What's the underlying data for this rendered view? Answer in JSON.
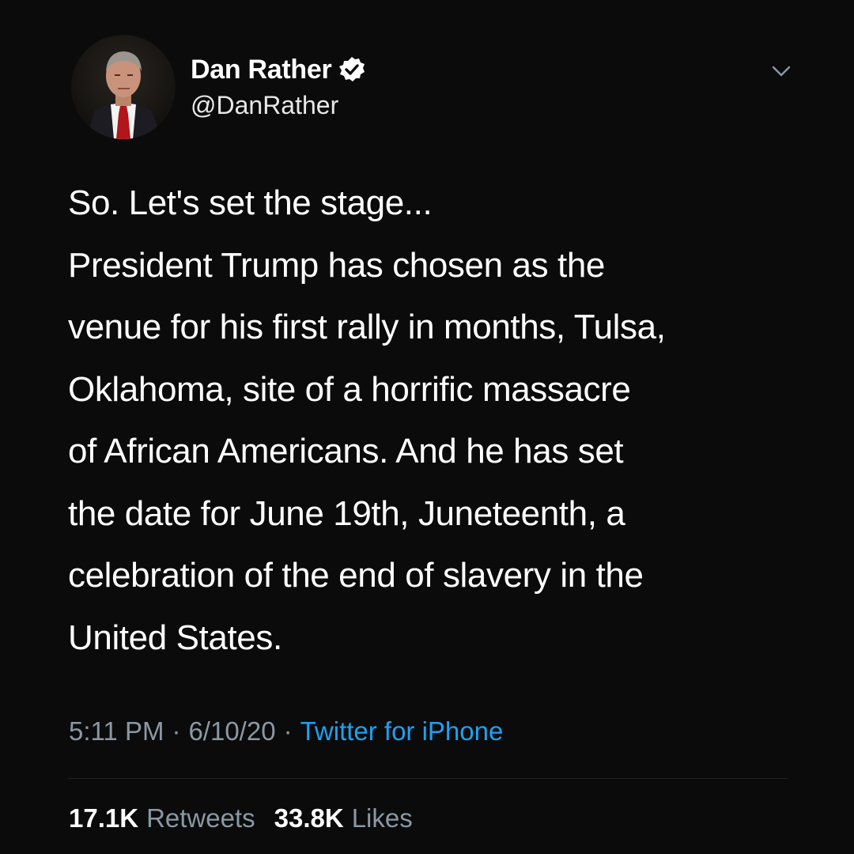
{
  "header": {
    "display_name": "Dan Rather",
    "handle": "@DanRather",
    "verified_icon": "verified-badge-icon",
    "menu_icon": "chevron-down-icon",
    "avatar": "profile-avatar"
  },
  "tweet": {
    "text": "So. Let's set the stage...\nPresident Trump has chosen as the\nvenue for his first rally in months, Tulsa,\nOklahoma, site of a horrific massacre\nof African Americans. And he has set\nthe date for June 19th, Juneteenth, a\ncelebration of the end of slavery in the\nUnited States."
  },
  "meta": {
    "time": "5:11 PM",
    "separator": "·",
    "date": "6/10/20",
    "source": "Twitter for iPhone"
  },
  "stats": {
    "retweets_count": "17.1K",
    "retweets_label": "Retweets",
    "likes_count": "33.8K",
    "likes_label": "Likes"
  },
  "colors": {
    "background": "#0b0b0b",
    "text": "#ffffff",
    "secondary": "#8b98a5",
    "link": "#1da1f2"
  }
}
